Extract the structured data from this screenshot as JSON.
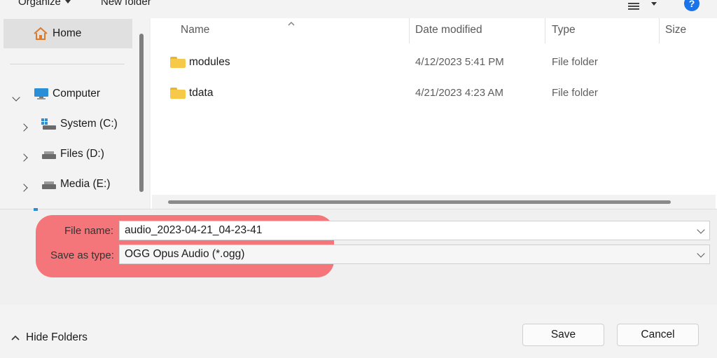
{
  "toolbar": {
    "organize_label": "Organize",
    "new_folder_label": "New folder",
    "help_label": "?"
  },
  "nav": {
    "items": [
      {
        "label": "Home",
        "icon": "home-icon"
      },
      {
        "label": "Computer",
        "icon": "computer-icon"
      },
      {
        "label": "System (C:)",
        "icon": "drive-icon"
      },
      {
        "label": "Files (D:)",
        "icon": "drive-icon"
      },
      {
        "label": "Media (E:)",
        "icon": "drive-icon"
      }
    ]
  },
  "list": {
    "columns": [
      "Name",
      "Date modified",
      "Type",
      "Size"
    ],
    "rows": [
      {
        "name": "modules",
        "date": "4/12/2023 5:41 PM",
        "type": "File folder"
      },
      {
        "name": "tdata",
        "date": "4/21/2023 4:23 AM",
        "type": "File folder"
      }
    ]
  },
  "form": {
    "file_name_label": "File name:",
    "file_name_value": "audio_2023-04-21_04-23-41",
    "save_type_label": "Save as type:",
    "save_type_value": "OGG Opus Audio (*.ogg)"
  },
  "footer": {
    "hide_folders_label": "Hide Folders",
    "save_label": "Save",
    "cancel_label": "Cancel"
  },
  "colors": {
    "highlight": "#f4767a",
    "folder": "#f7c948",
    "accent": "#1a73e8"
  }
}
